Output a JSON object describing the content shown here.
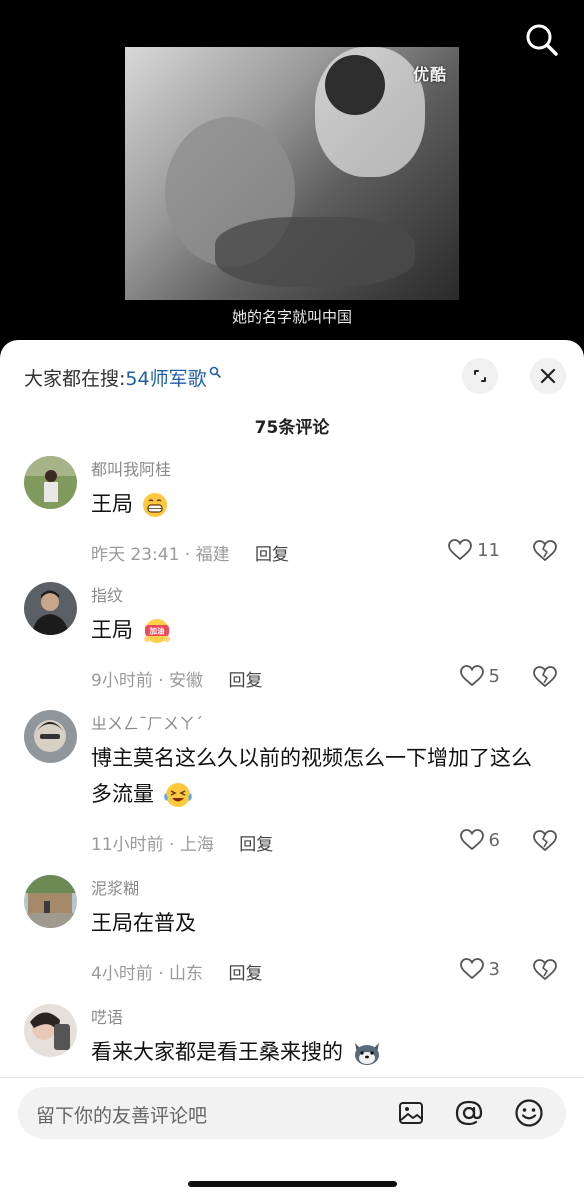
{
  "video": {
    "watermark": "优酷",
    "subtitle": "她的名字就叫中国"
  },
  "header": {
    "hot_search_prefix": "大家都在搜:",
    "hot_search_term": "54师军歌"
  },
  "comment_count": "75条评论",
  "comments": [
    {
      "username": "都叫我阿桂",
      "text": "王局",
      "emoji": "grinning-face",
      "time": "昨天 23:41",
      "location": "福建",
      "reply_label": "回复",
      "likes": "11"
    },
    {
      "username": "指纹",
      "text": "王局",
      "emoji": "jiayou-sticker",
      "emoji_text": "加油",
      "time": "9小时前",
      "location": "安徽",
      "reply_label": "回复",
      "likes": "5"
    },
    {
      "username": "ㄓㄨㄥˉㄏㄨㄚˊ",
      "text": "博主莫名这么久以前的视频怎么一下增加了这么多流量",
      "emoji": "laughing-tears",
      "time": "11小时前",
      "location": "上海",
      "reply_label": "回复",
      "likes": "6"
    },
    {
      "username": "泥浆糊",
      "text": "王局在普及",
      "time": "4小时前",
      "location": "山东",
      "reply_label": "回复",
      "likes": "3"
    },
    {
      "username": "呓语",
      "text": "看来大家都是看王桑来搜的",
      "emoji": "husky-dog"
    }
  ],
  "input": {
    "placeholder": "留下你的友善评论吧"
  },
  "colors": {
    "accent_link": "#1f5fa8",
    "sheet_bg": "#ffffff",
    "muted_text": "#9a9a9a"
  }
}
